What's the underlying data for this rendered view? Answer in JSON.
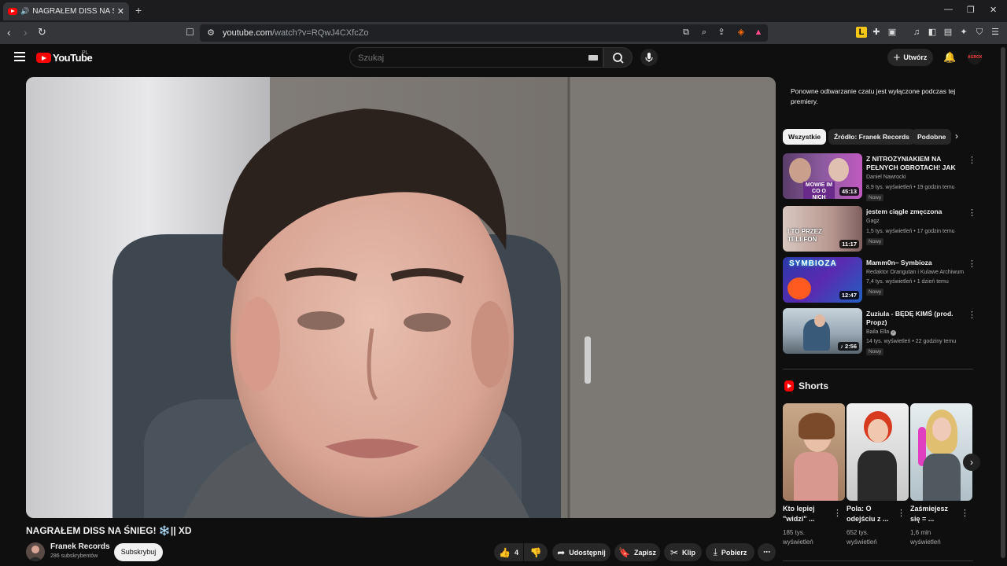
{
  "browser": {
    "tab_title": "NAGRAŁEM DISS NA ŚNIEG!",
    "url_host": "youtube.com",
    "url_path": "/watch?v=RQwJ4CXfcZo"
  },
  "header": {
    "logo_text": "YouTube",
    "country": "PL",
    "search_placeholder": "Szukaj",
    "create_label": "Utwórz",
    "avatar_text": "AGROX"
  },
  "video": {
    "title": "NAGRAŁEM DISS NA ŚNIEG! ❄️|| XD",
    "channel": "Franek Records",
    "subscribers": "286 subskrybentów",
    "subscribe_label": "Subskrybuj",
    "likes": "4",
    "share_label": "Udostępnij",
    "save_label": "Zapisz",
    "clip_label": "Klip",
    "download_label": "Pobierz"
  },
  "chat": {
    "message": "Ponowne odtwarzanie czatu jest wyłączone podczas tej premiery."
  },
  "chips": [
    "Wszystkie",
    "Źródło: Franek Records",
    "Podobne"
  ],
  "recommendations": [
    {
      "title": "Z NITROZYNIAKIEM NA PEŁNYCH OBROTACH! JAK ...",
      "channel": "Daniel Nawrocki",
      "meta": "8,9 tys. wyświetleń • 19 godzin temu",
      "badge": "Nowy",
      "duration": "45:13",
      "thumb_text": "MOWIE IM CO O NICH"
    },
    {
      "title": "jestem ciągle zmęczona",
      "channel": "Gagz",
      "meta": "1,5 tys. wyświetleń • 17 godzin temu",
      "badge": "Nowy",
      "duration": "11:17",
      "thumb_text": "I TO PRZEZ TELEFON"
    },
    {
      "title": "Mamm0n– Symbioza",
      "channel": "Redaktor Orangutan i Kulawe Archiwum",
      "meta": "7,4 tys. wyświetleń • 1 dzień temu",
      "badge": "Nowy",
      "duration": "12:47",
      "thumb_text": "SYMBIOZA"
    },
    {
      "title": "Zuziula - BĘDĘ KIMŚ (prod. Propz)",
      "channel": "Baila Ella",
      "meta": "14 tys. wyświetleń • 22 godziny temu",
      "badge": "Nowy",
      "duration": "2:56",
      "thumb_text": ""
    }
  ],
  "shorts": {
    "heading": "Shorts",
    "items": [
      {
        "title": "Kto lepiej \"widzi\" ...",
        "views": "185 tys. wyświetleń"
      },
      {
        "title": "Pola: O odejściu z ...",
        "views": "652 tys. wyświetleń"
      },
      {
        "title": "Zaśmiejesz się = ...",
        "views": "1,6 mln wyświetleń"
      }
    ]
  },
  "colors": {
    "background": "#0f0f0f",
    "accent": "#ff0000",
    "chip_active": "#f1f1f1",
    "button": "#272727"
  }
}
